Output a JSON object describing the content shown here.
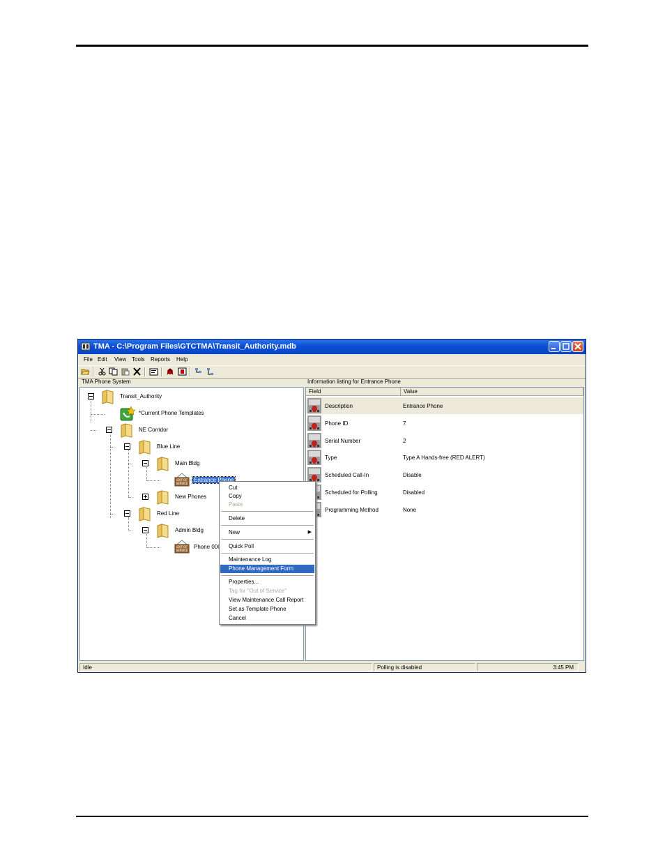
{
  "window": {
    "title": "TMA - C:\\Program Files\\GTCTMA\\Transit_Authority.mdb"
  },
  "menu": [
    "File",
    "Edit",
    "View",
    "Tools",
    "Reports",
    "Help"
  ],
  "tree_pane": {
    "header": "TMA Phone System",
    "nodes": {
      "root": "Transit_Authority",
      "templates": "*Current Phone Templates",
      "ne_corridor": "NE Corridor",
      "blue_line": "Blue Line",
      "main_bldg": "Main Bldg",
      "entrance_phone": "Entrance Phone",
      "new_phones": "New Phones",
      "red_line": "Red Line",
      "admin_bldg": "Admin Bldg",
      "phone_000": "Phone 000",
      "out_of_service_tag": "OUT OF SERVICE"
    }
  },
  "list_pane": {
    "header": "Information listing for Entrance Phone",
    "columns": [
      "Field",
      "Value"
    ],
    "rows": [
      {
        "field": "Description",
        "value": "Entrance Phone"
      },
      {
        "field": "Phone ID",
        "value": "7"
      },
      {
        "field": "Serial Number",
        "value": "2"
      },
      {
        "field": "Type",
        "value": "Type A Hands-free (RED ALERT)"
      },
      {
        "field": "Scheduled Call-In",
        "value": "Disable"
      },
      {
        "field": "Scheduled for Polling",
        "value": "Disabled"
      },
      {
        "field": "Programming Method",
        "value": "None"
      }
    ]
  },
  "context_menu": {
    "cut": "Cut",
    "copy": "Copy",
    "paste": "Paste",
    "delete": "Delete",
    "new": "New",
    "quick_poll": "Quick Poll",
    "maintenance_log": "Maintenance Log",
    "phone_management_form": "Phone Management Form",
    "properties": "Properties...",
    "tag_out_of_service": "Tag for \"Out of Service\"",
    "view_maintenance_call_report": "View Maintenance Call Report",
    "set_as_template": "Set as Template Phone",
    "cancel": "Cancel"
  },
  "status_bar": {
    "state": "Idle",
    "polling": "Polling is disabled",
    "time": "3:45 PM"
  },
  "colors": {
    "titlebar": "#0a4fd6",
    "selection": "#316ac5",
    "window_face": "#ece9d8"
  },
  "icons": [
    "folder-icon",
    "template-phone-icon",
    "out-of-service-phone-icon",
    "phone-row-icon",
    "submenu-arrow-icon"
  ]
}
